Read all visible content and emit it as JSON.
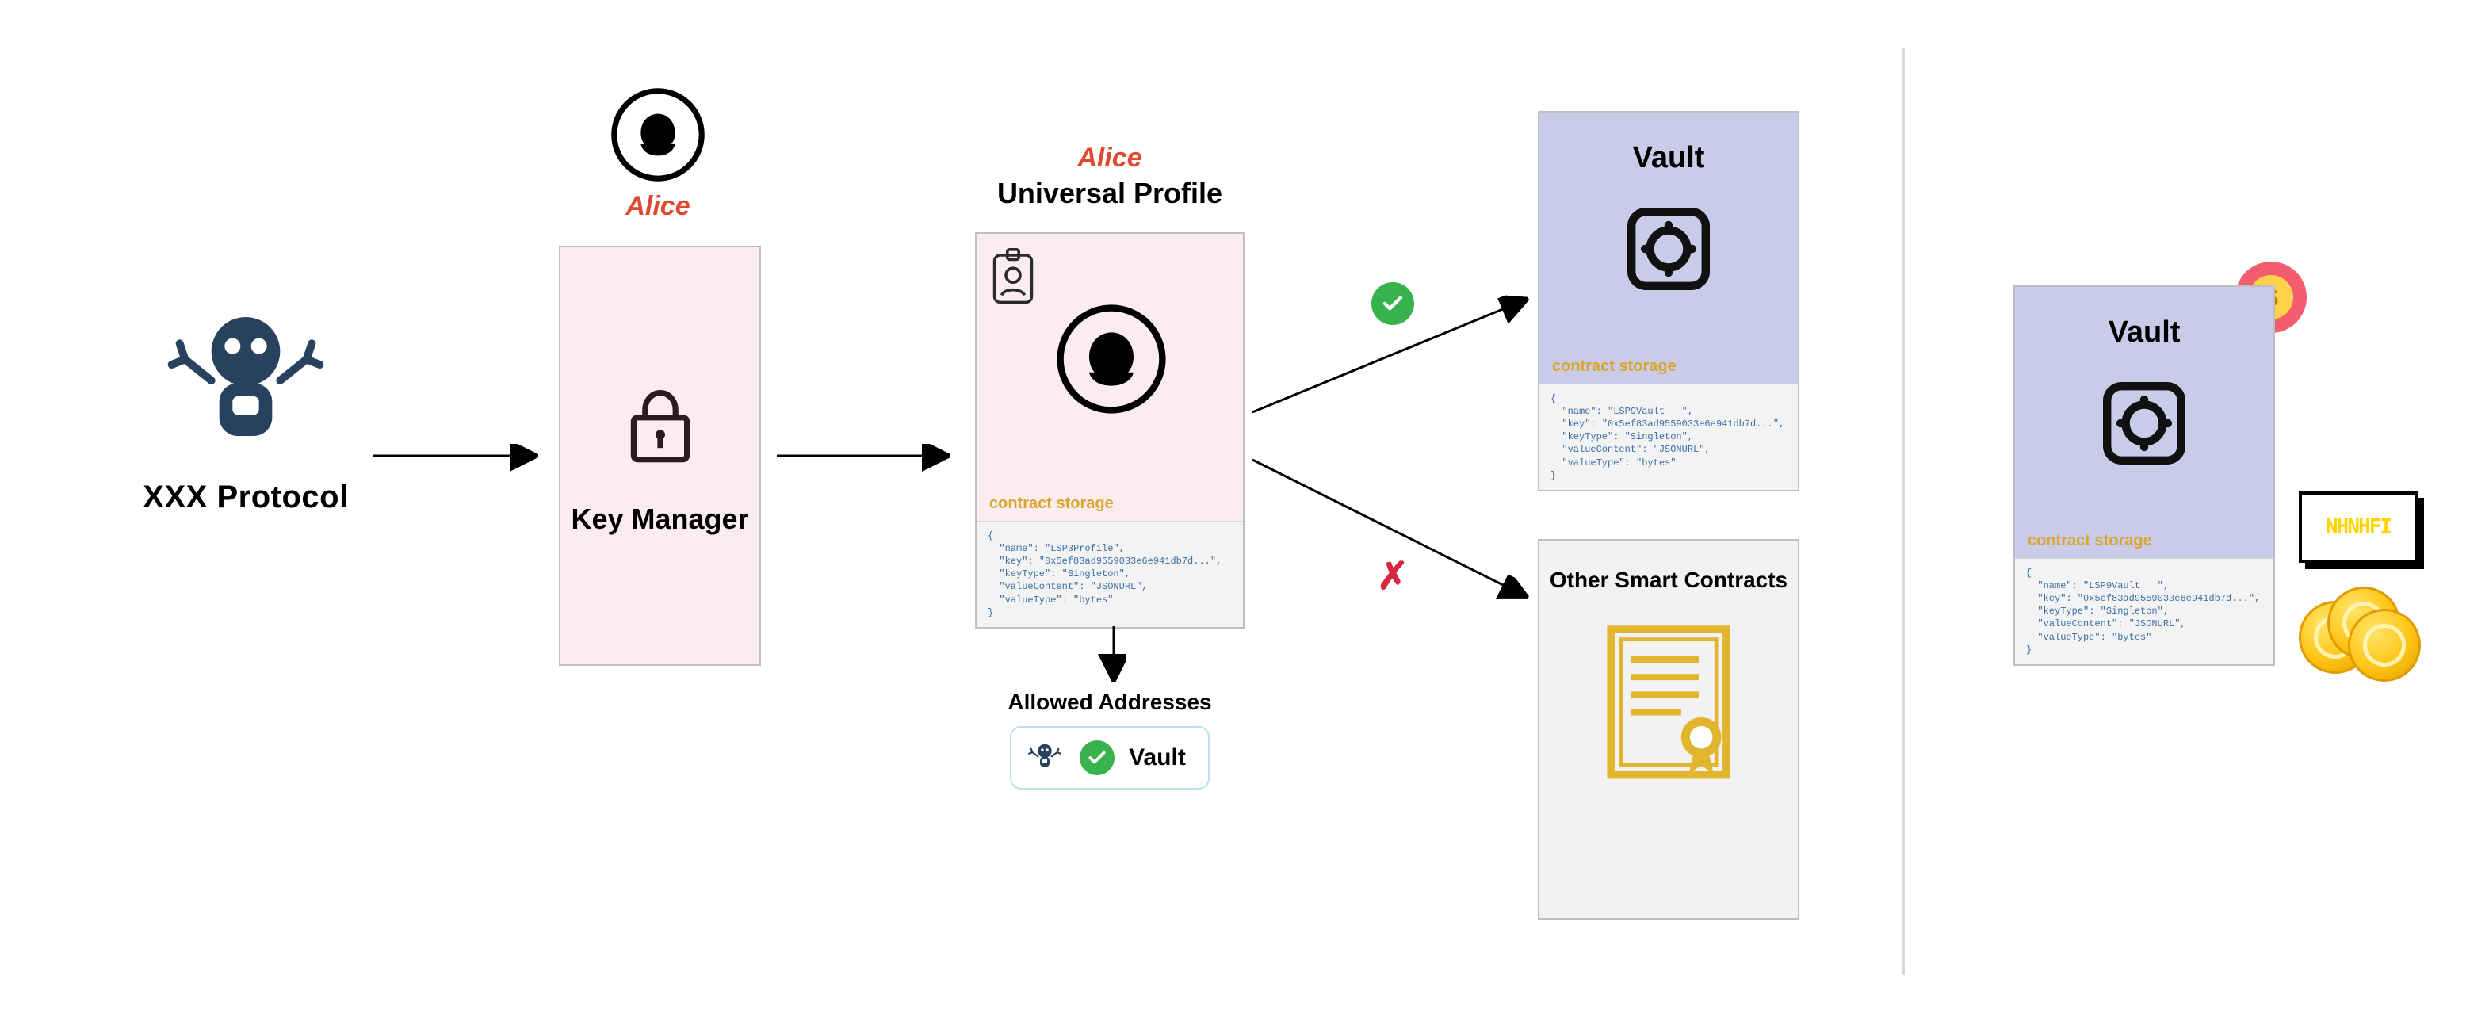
{
  "protocol": {
    "label": "XXX Protocol"
  },
  "alice": {
    "name": "Alice"
  },
  "keyManager": {
    "title": "Key Manager"
  },
  "universalProfile": {
    "owner": "Alice",
    "title": "Universal Profile",
    "storageLabel": "contract storage",
    "storageJson": "{\n  \"name\": \"LSP3Profile\",\n  \"key\": \"0x5ef83ad9559033e6e941db7d...\",\n  \"keyType\": \"Singleton\",\n  \"valueContent\": \"JSONURL\",\n  \"valueType\": \"bytes\"\n}"
  },
  "allowed": {
    "title": "Allowed Addresses",
    "item": "Vault"
  },
  "vaultCard": {
    "title": "Vault",
    "storageLabel": "contract storage",
    "storageJson": "{\n  \"name\": \"LSP9Vault   \",\n  \"key\": \"0x5ef83ad9559033e6e941db7d...\",\n  \"keyType\": \"Singleton\",\n  \"valueContent\": \"JSONURL\",\n  \"valueType\": \"bytes\"\n}"
  },
  "otherContracts": {
    "title": "Other Smart Contracts"
  },
  "nftLabel": "NHNHFI",
  "icons": {
    "robot": "robot-icon",
    "avatar": "person-silhouette-icon",
    "lock": "lock-icon",
    "badge": "id-badge-icon",
    "vault": "vault-safe-icon",
    "doc": "certificate-document-icon",
    "check": "checkmark-icon",
    "cross": "x-icon"
  }
}
